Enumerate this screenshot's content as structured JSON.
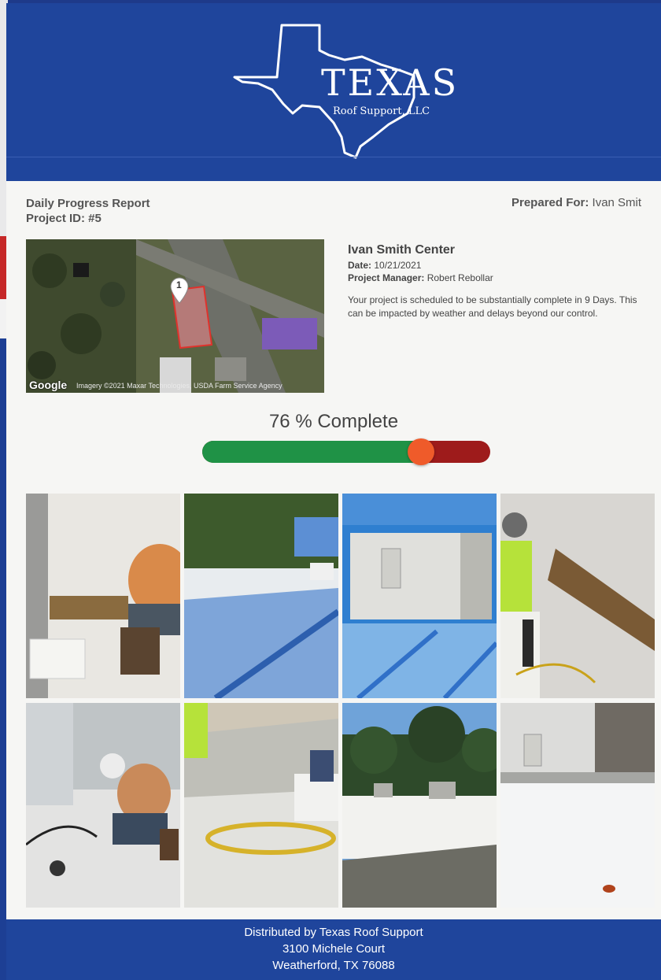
{
  "brand": {
    "name": "TEXAS",
    "subtitle": "Roof Support, LLC"
  },
  "report": {
    "title": "Daily Progress Report",
    "project_id": "Project ID: #5",
    "prepared_for_label": "Prepared For:",
    "prepared_for_value": "Ivan Smit"
  },
  "map": {
    "marker": "1",
    "google": "Google",
    "credit": "Imagery ©2021 Maxar Technologies, USDA Farm Service Agency"
  },
  "project": {
    "name": "Ivan Smith Center",
    "date_label": "Date:",
    "date_value": "10/21/2021",
    "manager_label": "Project Manager:",
    "manager_value": "Robert Rebollar",
    "message": "Your project is scheduled to be substantially complete in 9 Days. This can be impacted by weather and delays beyond our control."
  },
  "progress": {
    "label": "76 % Complete",
    "percent": 76
  },
  "photos": [
    "photo-worker-wall-flashing",
    "photo-roof-blue-membrane",
    "photo-hvac-unit",
    "photo-worker-green-shirt",
    "photo-worker-kneeling",
    "photo-roof-yellow-cord",
    "photo-roof-trees",
    "photo-hvac-curb"
  ],
  "footer": {
    "line1": "Distributed by Texas Roof Support",
    "line2": "3100 Michele Court",
    "line3": "Weatherford, TX 76088"
  },
  "colors": {
    "header_blue": "#1f459c",
    "progress_green": "#1f9246",
    "progress_red": "#9e1b1b",
    "knob_orange": "#ef5b2a"
  }
}
